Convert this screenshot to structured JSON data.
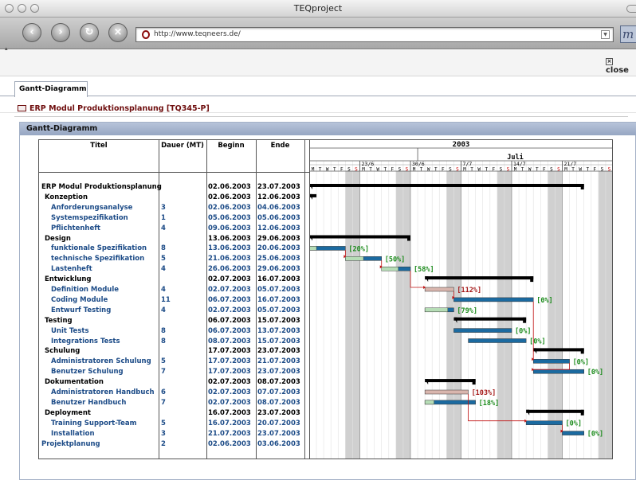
{
  "window": {
    "title": "TEQproject"
  },
  "toolbar": {
    "url": "http://www.teqneers.de/",
    "back": "back",
    "forward": "forward",
    "reload": "reload",
    "stop": "stop"
  },
  "header": {
    "close_label": "close"
  },
  "tab": {
    "label": "Gantt-Diagramm"
  },
  "breadcrumb": "ERP Modul Produktionsplanung [TQ345-P]",
  "panel": {
    "title": "Gantt-Diagramm"
  },
  "columns": {
    "titel": "Titel",
    "dauer": "Dauer (MT)",
    "beginn": "Beginn",
    "ende": "Ende"
  },
  "timeline": {
    "year": "2003",
    "month": "Juli",
    "weeks": [
      "23/6",
      "30/6",
      "7/7",
      "14/7",
      "21/7"
    ],
    "weekday_letters": [
      "M",
      "T",
      "W",
      "T",
      "F",
      "S",
      "S"
    ],
    "start_date": "2003-06-16",
    "end_date": "2003-07-27"
  },
  "colors": {
    "summary": "#000000",
    "done": "#0c1a64",
    "active": "#1b6aa0",
    "late": "#a31515",
    "ok": "#1a8a1a",
    "progress_late": "#d9b6ae",
    "progress_ok": "#b6ddb6",
    "weekend": "#d0d0d0"
  },
  "tasks": [
    {
      "title": "ERP Modul Produktionsplanung",
      "level": 0,
      "dauer": "",
      "beginn": "02.06.2003",
      "ende": "23.07.2003",
      "type": "summary"
    },
    {
      "title": "Konzeption",
      "level": 1,
      "dauer": "",
      "beginn": "02.06.2003",
      "ende": "12.06.2003",
      "type": "summary"
    },
    {
      "title": "Anforderungsanalyse",
      "level": 2,
      "dauer": "3",
      "beginn": "02.06.2003",
      "ende": "04.06.2003",
      "type": "task"
    },
    {
      "title": "Systemspezifikation",
      "level": 2,
      "dauer": "1",
      "beginn": "05.06.2003",
      "ende": "05.06.2003",
      "type": "task"
    },
    {
      "title": "Pflichtenheft",
      "level": 2,
      "dauer": "4",
      "beginn": "09.06.2003",
      "ende": "12.06.2003",
      "type": "task"
    },
    {
      "title": "Design",
      "level": 1,
      "dauer": "",
      "beginn": "13.06.2003",
      "ende": "29.06.2003",
      "type": "summary"
    },
    {
      "title": "funktionale Spezifikation",
      "level": 2,
      "dauer": "8",
      "beginn": "13.06.2003",
      "ende": "20.06.2003",
      "type": "task",
      "percent": "[20%]",
      "status": "ok"
    },
    {
      "title": "technische Spezifikation",
      "level": 2,
      "dauer": "5",
      "beginn": "21.06.2003",
      "ende": "25.06.2003",
      "type": "task",
      "percent": "[50%]",
      "status": "ok"
    },
    {
      "title": "Lastenheft",
      "level": 2,
      "dauer": "4",
      "beginn": "26.06.2003",
      "ende": "29.06.2003",
      "type": "task",
      "percent": "[58%]",
      "status": "ok"
    },
    {
      "title": "Entwicklung",
      "level": 1,
      "dauer": "",
      "beginn": "02.07.2003",
      "ende": "16.07.2003",
      "type": "summary"
    },
    {
      "title": "Definition Module",
      "level": 2,
      "dauer": "4",
      "beginn": "02.07.2003",
      "ende": "05.07.2003",
      "type": "task",
      "percent": "[112%]",
      "status": "late"
    },
    {
      "title": "Coding Module",
      "level": 2,
      "dauer": "11",
      "beginn": "06.07.2003",
      "ende": "16.07.2003",
      "type": "task",
      "percent": "[0%]",
      "status": "ok"
    },
    {
      "title": "Entwurf Testing",
      "level": 2,
      "dauer": "4",
      "beginn": "02.07.2003",
      "ende": "05.07.2003",
      "type": "task",
      "percent": "[79%]",
      "status": "ok"
    },
    {
      "title": "Testing",
      "level": 1,
      "dauer": "",
      "beginn": "06.07.2003",
      "ende": "15.07.2003",
      "type": "summary"
    },
    {
      "title": "Unit Tests",
      "level": 2,
      "dauer": "8",
      "beginn": "06.07.2003",
      "ende": "13.07.2003",
      "type": "task",
      "percent": "[0%]",
      "status": "ok"
    },
    {
      "title": "Integrations Tests",
      "level": 2,
      "dauer": "8",
      "beginn": "08.07.2003",
      "ende": "15.07.2003",
      "type": "task",
      "percent": "[0%]",
      "status": "ok"
    },
    {
      "title": "Schulung",
      "level": 1,
      "dauer": "",
      "beginn": "17.07.2003",
      "ende": "23.07.2003",
      "type": "summary"
    },
    {
      "title": "Administratoren Schulung",
      "level": 2,
      "dauer": "5",
      "beginn": "17.07.2003",
      "ende": "21.07.2003",
      "type": "task",
      "percent": "[0%]",
      "status": "ok"
    },
    {
      "title": "Benutzer Schulung",
      "level": 2,
      "dauer": "7",
      "beginn": "17.07.2003",
      "ende": "23.07.2003",
      "type": "task",
      "percent": "[0%]",
      "status": "ok"
    },
    {
      "title": "Dokumentation",
      "level": 1,
      "dauer": "",
      "beginn": "02.07.2003",
      "ende": "08.07.2003",
      "type": "summary"
    },
    {
      "title": "Administratoren Handbuch",
      "level": 2,
      "dauer": "6",
      "beginn": "02.07.2003",
      "ende": "07.07.2003",
      "type": "task",
      "percent": "[103%]",
      "status": "late"
    },
    {
      "title": "Benutzer Handbuch",
      "level": 2,
      "dauer": "7",
      "beginn": "02.07.2003",
      "ende": "08.07.2003",
      "type": "task",
      "percent": "[18%]",
      "status": "ok"
    },
    {
      "title": "Deployment",
      "level": 1,
      "dauer": "",
      "beginn": "16.07.2003",
      "ende": "23.07.2003",
      "type": "summary"
    },
    {
      "title": "Training Support-Team",
      "level": 2,
      "dauer": "5",
      "beginn": "16.07.2003",
      "ende": "20.07.2003",
      "type": "task",
      "percent": "[0%]",
      "status": "ok"
    },
    {
      "title": "Installation",
      "level": 2,
      "dauer": "3",
      "beginn": "21.07.2003",
      "ende": "23.07.2003",
      "type": "task",
      "percent": "[0%]",
      "status": "ok"
    },
    {
      "title": "Projektplanung",
      "level": 1,
      "dauer": "2",
      "beginn": "02.06.2003",
      "ende": "03.06.2003",
      "type": "task",
      "plain": true
    }
  ]
}
